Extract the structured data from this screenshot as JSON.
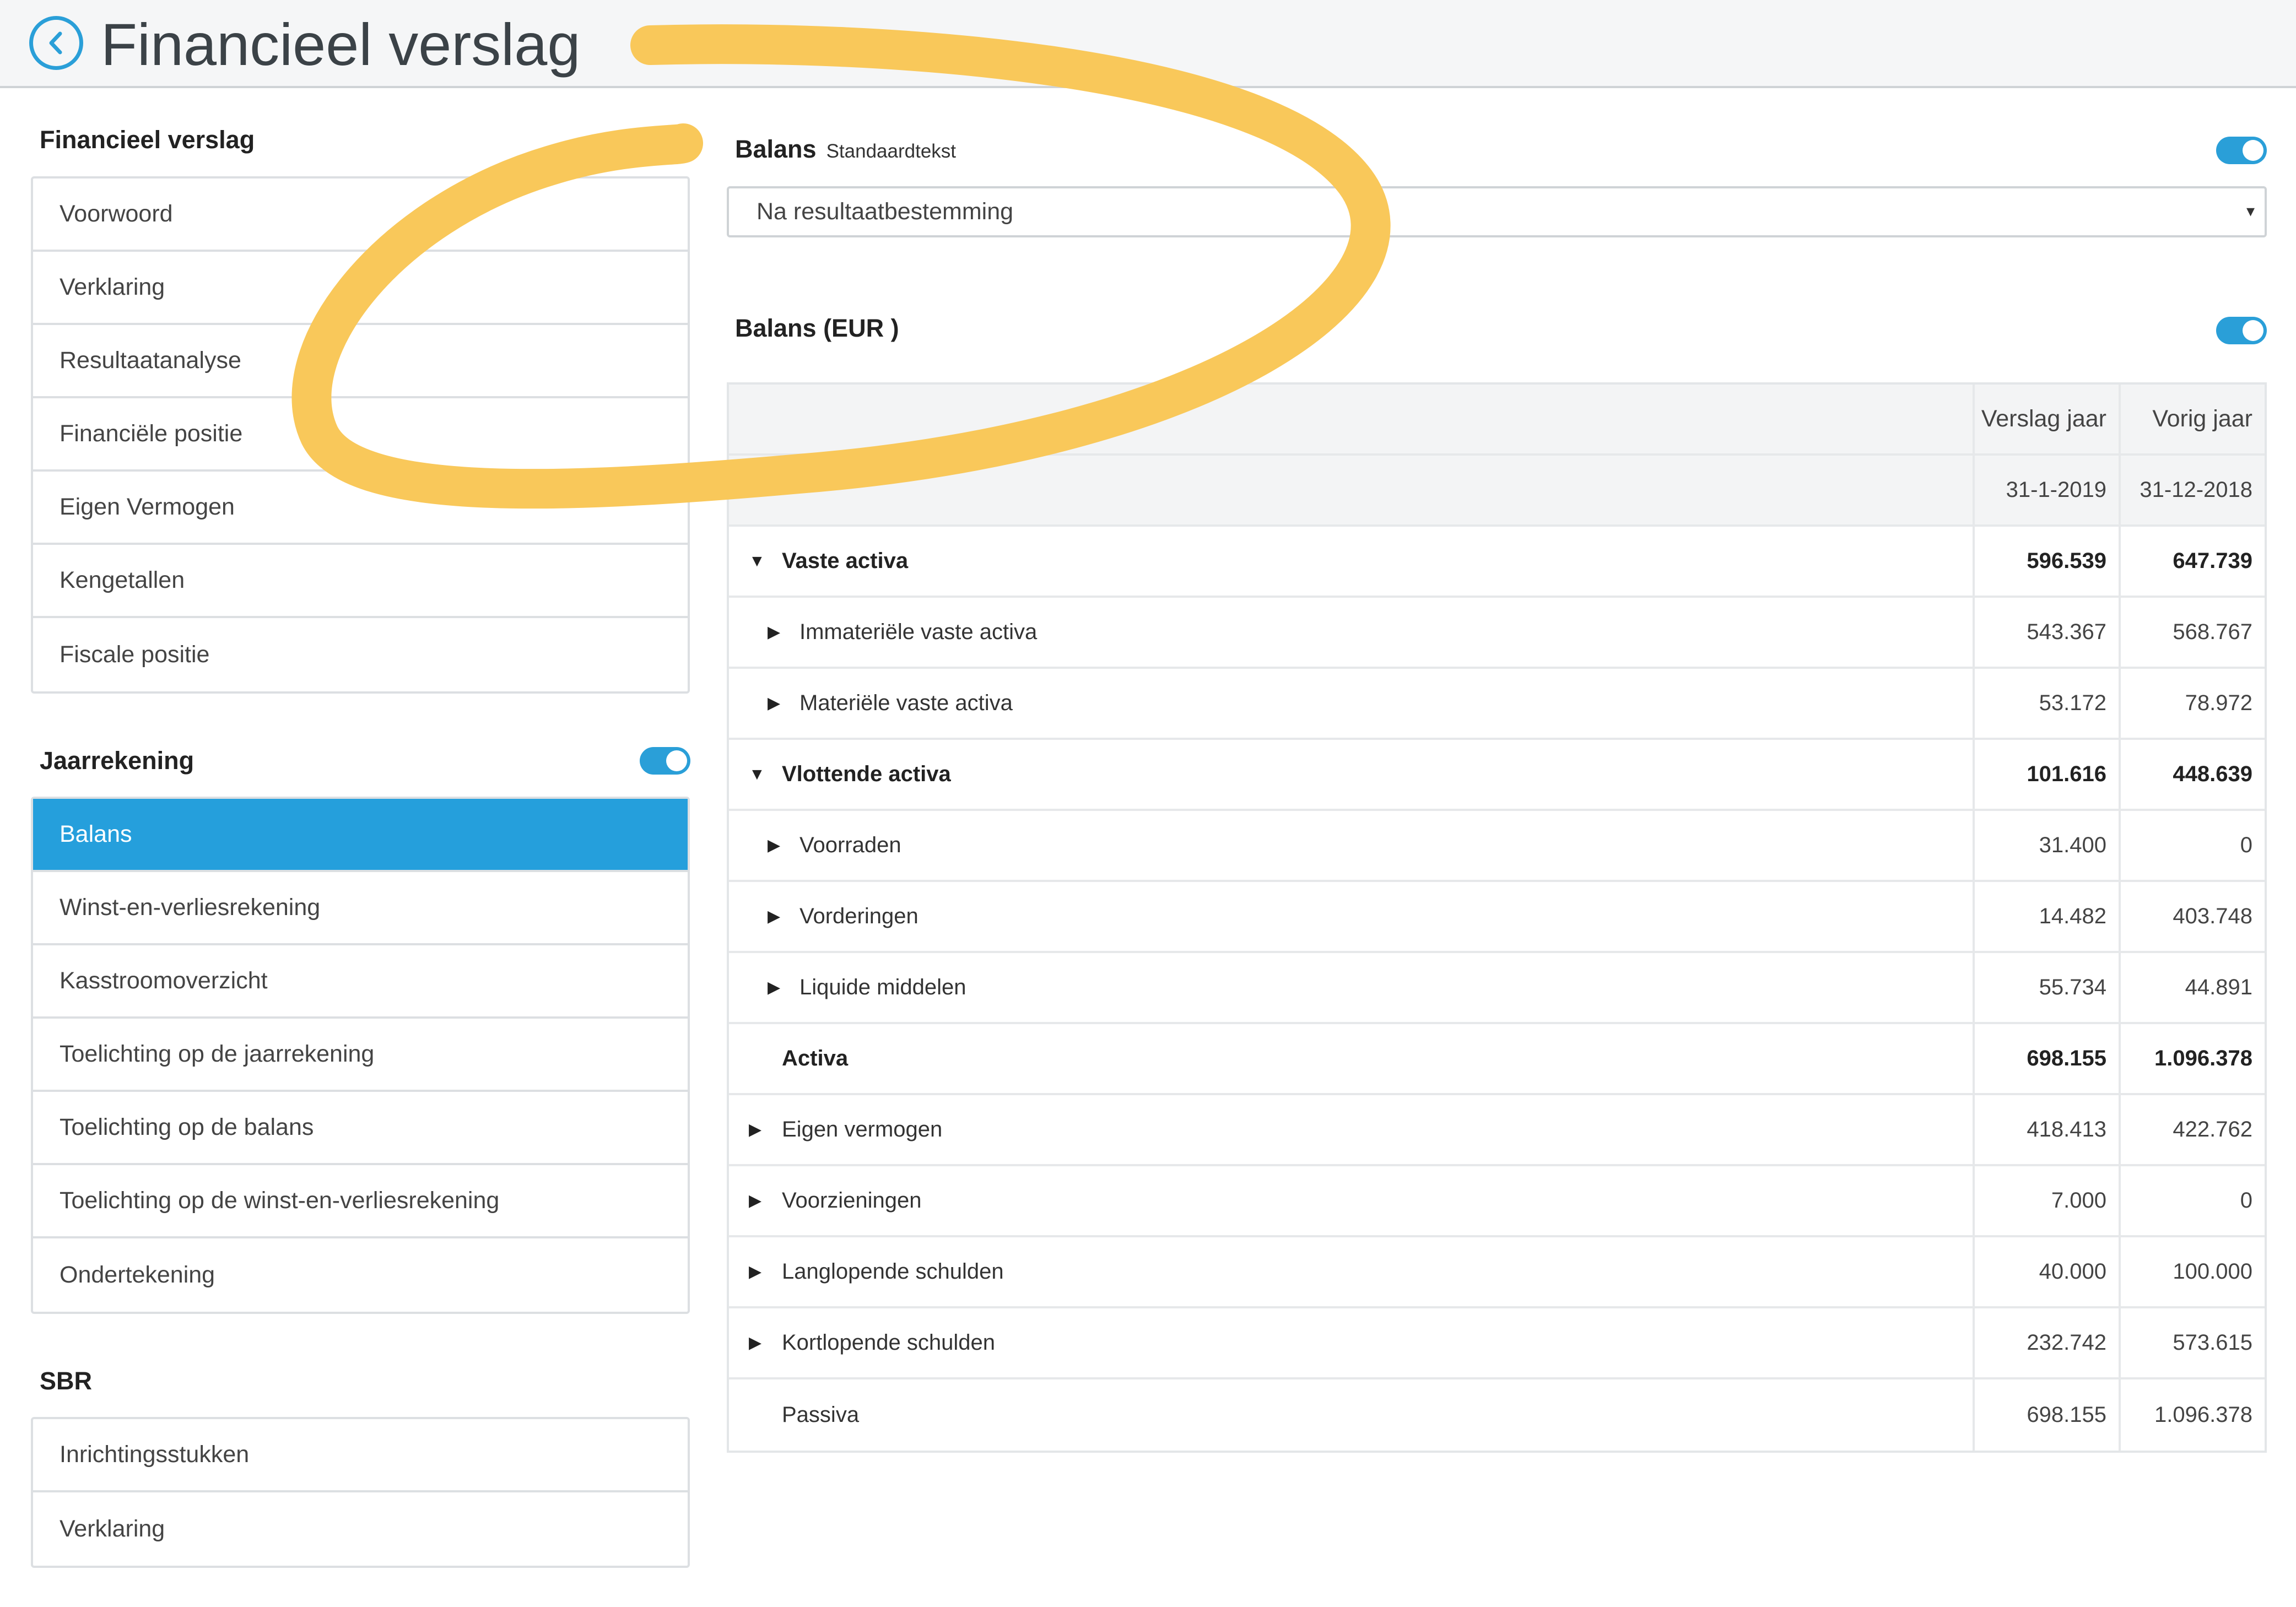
{
  "header": {
    "title": "Financieel verslag"
  },
  "sidebar": {
    "financieel_verslag": {
      "title": "Financieel verslag",
      "items": [
        "Voorwoord",
        "Verklaring",
        "Resultaatanalyse",
        "Financiële positie",
        "Eigen Vermogen",
        "Kengetallen",
        "Fiscale positie"
      ]
    },
    "jaarrekening": {
      "title": "Jaarrekening",
      "toggle_on": true,
      "items": [
        "Balans",
        "Winst-en-verliesrekening",
        "Kasstroomoverzicht",
        "Toelichting op de jaarrekening",
        "Toelichting op de balans",
        "Toelichting op de winst-en-verliesrekening",
        "Ondertekening"
      ],
      "active_item": "Balans"
    },
    "sbr": {
      "title": "SBR",
      "items": [
        "Inrichtingsstukken",
        "Verklaring"
      ]
    }
  },
  "main": {
    "balans_section": {
      "title": "Balans",
      "subtitle": "Standaardtekst",
      "toggle_on": true,
      "select_value": "Na resultaatbestemming",
      "select_arrow": "▾"
    },
    "balans_table_section": {
      "title": "Balans (EUR )",
      "toggle_on": true
    },
    "table": {
      "columns": [
        "Verslag jaar",
        "Vorig jaar"
      ],
      "dates": [
        "31-1-2019",
        "31-12-2018"
      ],
      "rows": [
        {
          "label": "Vaste activa",
          "v1": "596.539",
          "v2": "647.739",
          "bold": true,
          "caret": "down",
          "indent": 0
        },
        {
          "label": "Immateriële vaste activa",
          "v1": "543.367",
          "v2": "568.767",
          "bold": false,
          "caret": "right",
          "indent": 1
        },
        {
          "label": "Materiële vaste activa",
          "v1": "53.172",
          "v2": "78.972",
          "bold": false,
          "caret": "right",
          "indent": 1
        },
        {
          "label": "Vlottende activa",
          "v1": "101.616",
          "v2": "448.639",
          "bold": true,
          "caret": "down",
          "indent": 0
        },
        {
          "label": "Voorraden",
          "v1": "31.400",
          "v2": "0",
          "bold": false,
          "caret": "right",
          "indent": 1
        },
        {
          "label": "Vorderingen",
          "v1": "14.482",
          "v2": "403.748",
          "bold": false,
          "caret": "right",
          "indent": 1
        },
        {
          "label": "Liquide middelen",
          "v1": "55.734",
          "v2": "44.891",
          "bold": false,
          "caret": "right",
          "indent": 1
        },
        {
          "label": "Activa",
          "v1": "698.155",
          "v2": "1.096.378",
          "bold": true,
          "caret": "none",
          "indent": 0
        },
        {
          "label": "Eigen vermogen",
          "v1": "418.413",
          "v2": "422.762",
          "bold": false,
          "caret": "right",
          "indent": 0
        },
        {
          "label": "Voorzieningen",
          "v1": "7.000",
          "v2": "0",
          "bold": false,
          "caret": "right",
          "indent": 0
        },
        {
          "label": "Langlopende schulden",
          "v1": "40.000",
          "v2": "100.000",
          "bold": false,
          "caret": "right",
          "indent": 0
        },
        {
          "label": "Kortlopende schulden",
          "v1": "232.742",
          "v2": "573.615",
          "bold": false,
          "caret": "right",
          "indent": 0
        },
        {
          "label": "Passiva",
          "v1": "698.155",
          "v2": "1.096.378",
          "bold": false,
          "caret": "none",
          "indent": 0
        }
      ]
    }
  },
  "colors": {
    "accent": "#259fdc",
    "highlight_stroke": "#f9c85a"
  },
  "icons": {
    "back": "chevron-left-circle-icon",
    "expanded": "caret-down-icon",
    "collapsed": "caret-right-icon"
  }
}
